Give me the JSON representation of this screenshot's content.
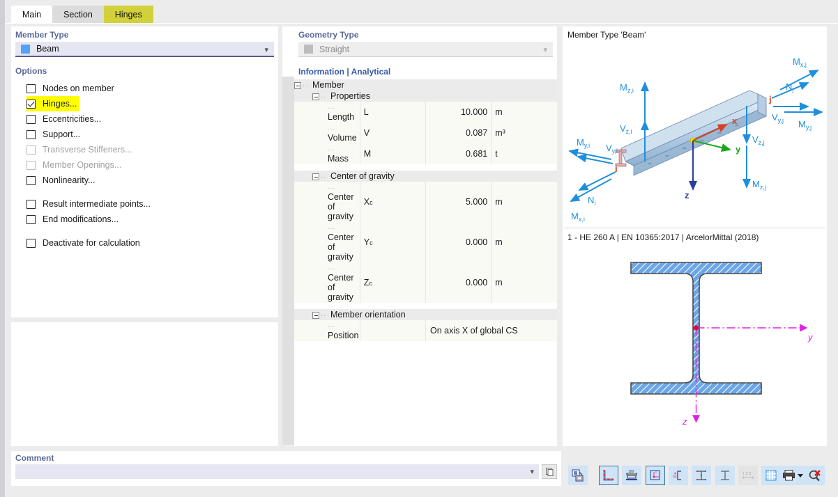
{
  "tabs": [
    {
      "label": "Main",
      "state": "active"
    },
    {
      "label": "Section",
      "state": "inactive"
    },
    {
      "label": "Hinges",
      "state": "highlight"
    }
  ],
  "left": {
    "member_type_title": "Member Type",
    "member_type_value": "Beam",
    "member_type_swatch": "#54a2f5",
    "options_title": "Options",
    "options": [
      {
        "label": "Nodes on member",
        "checked": false,
        "disabled": false,
        "marked": false
      },
      {
        "label": "Hinges...",
        "checked": true,
        "disabled": false,
        "marked": true
      },
      {
        "label": "Eccentricities...",
        "checked": false,
        "disabled": false,
        "marked": false
      },
      {
        "label": "Support...",
        "checked": false,
        "disabled": false,
        "marked": false
      },
      {
        "label": "Transverse Stiffeners...",
        "checked": false,
        "disabled": true,
        "marked": false
      },
      {
        "label": "Member Openings...",
        "checked": false,
        "disabled": true,
        "marked": false
      },
      {
        "label": "Nonlinearity...",
        "checked": false,
        "disabled": false,
        "marked": false
      },
      {
        "label": "Result intermediate points...",
        "checked": false,
        "disabled": false,
        "marked": false
      },
      {
        "label": "End modifications...",
        "checked": false,
        "disabled": false,
        "marked": false
      },
      {
        "label": "Deactivate for calculation",
        "checked": false,
        "disabled": false,
        "marked": false
      }
    ]
  },
  "comment": {
    "title": "Comment",
    "value": "",
    "placeholder": ""
  },
  "middle": {
    "geometry_title": "Geometry Type",
    "geometry_value": "Straight",
    "info_header": "Information | Analytical",
    "group_member": "Member",
    "group_properties": "Properties",
    "group_cog": "Center of gravity",
    "group_orientation": "Member orientation",
    "rows_properties": [
      {
        "label": "Length",
        "symbol": "L",
        "value": "10.000",
        "unit": "m"
      },
      {
        "label": "Volume",
        "symbol": "V",
        "value": "0.087",
        "unit": "m³"
      },
      {
        "label": "Mass",
        "symbol": "M",
        "value": "0.681",
        "unit": "t"
      }
    ],
    "rows_cog": [
      {
        "label": "Center of gravity",
        "symbol": "Xc",
        "value": "5.000",
        "unit": "m"
      },
      {
        "label": "Center of gravity",
        "symbol": "Yc",
        "value": "0.000",
        "unit": "m"
      },
      {
        "label": "Center of gravity",
        "symbol": "Zc",
        "value": "0.000",
        "unit": "m"
      }
    ],
    "rows_orientation": [
      {
        "label": "Position",
        "symbol": "",
        "value": "On axis X of global CS"
      }
    ]
  },
  "right": {
    "beam_caption": "Member Type 'Beam'",
    "section_caption": "1 - HE 260 A | EN 10365:2017 | ArcelorMittal (2018)",
    "beam_labels": {
      "mzi": "M",
      "node_i": "i",
      "node_j": "j",
      "axis_x": "x",
      "axis_y": "y",
      "axis_z": "z"
    },
    "force_labels": [
      "M z,i",
      "V z,i",
      "M y,i",
      "V y,i",
      "N i",
      "M x,i",
      "N j",
      "M x,j",
      "V y,j",
      "M y,j",
      "V z,j",
      "M z,j"
    ],
    "section_axis_y": "y",
    "section_axis_z": "z",
    "colors": {
      "force_arrow": "#1f8fdd",
      "axis_x": "#d4421e",
      "axis_y": "#17a81a",
      "axis_z": "#2b3f9e",
      "section_fill": "#6aa6e8",
      "section_axis": "#e020e0"
    }
  },
  "toolbar": {
    "buttons": [
      {
        "name": "export-view",
        "state": "normal"
      },
      {
        "name": "corner-dims",
        "state": "selected"
      },
      {
        "name": "overall-dims",
        "state": "normal"
      },
      {
        "name": "axes-system",
        "state": "selected"
      },
      {
        "name": "shear-center",
        "state": "normal"
      },
      {
        "name": "principal-axes",
        "state": "normal"
      },
      {
        "name": "section-outline",
        "state": "normal"
      },
      {
        "name": "numbering",
        "state": "disabled"
      },
      {
        "name": "grid",
        "state": "normal"
      },
      {
        "name": "stress-points",
        "state": "normal"
      },
      {
        "name": "print",
        "state": "normal"
      },
      {
        "name": "reset-zoom",
        "state": "normal"
      }
    ]
  }
}
